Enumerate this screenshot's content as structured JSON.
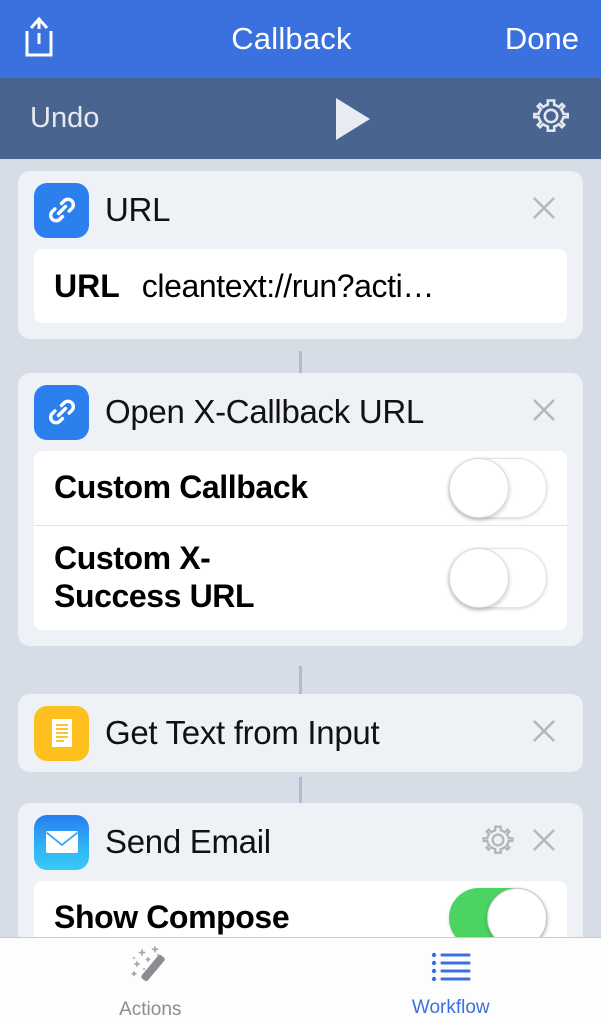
{
  "navbar": {
    "share_icon": "share-icon",
    "title": "Callback",
    "done_label": "Done"
  },
  "toolbar": {
    "undo_label": "Undo",
    "play_icon": "play-icon",
    "settings_icon": "gear-icon"
  },
  "colors": {
    "navbar_bg": "#3a71de",
    "toolbar_bg": "#4a6490",
    "page_bg": "#d7dde6",
    "card_bg": "#eef1f6",
    "accent_blue": "#2b80ee",
    "accent_yellow": "#fdc01f",
    "toggle_on_green": "#4cd462",
    "tab_active": "#3a71de",
    "tab_inactive": "#8c8c91"
  },
  "actions": [
    {
      "title": "URL",
      "icon": "link-icon",
      "icon_color": "#2b80ee",
      "close_icon": "close-icon",
      "params": [
        {
          "type": "text",
          "key": "URL",
          "value": "cleantext://run?acti…"
        }
      ]
    },
    {
      "title": "Open X-Callback URL",
      "icon": "link-icon",
      "icon_color": "#2b80ee",
      "close_icon": "close-icon",
      "params": [
        {
          "type": "switch",
          "label": "Custom Callback",
          "value": "off"
        },
        {
          "type": "switch",
          "label": "Custom X-\nSuccess URL",
          "value": "off"
        }
      ]
    },
    {
      "title": "Get Text from Input",
      "icon": "document-icon",
      "icon_color": "#fdc01f",
      "close_icon": "close-icon",
      "params": []
    },
    {
      "title": "Send Email",
      "icon": "mail-icon",
      "icon_color": "#2a7cf0",
      "settings_icon": "gear-icon",
      "close_icon": "close-icon",
      "params": [
        {
          "type": "switch",
          "label": "Show Compose",
          "value": "on"
        }
      ]
    }
  ],
  "tabbar": {
    "tabs": [
      {
        "label": "Actions",
        "icon": "magic-wand-icon",
        "active": false
      },
      {
        "label": "Workflow",
        "icon": "list-icon",
        "active": true
      }
    ]
  }
}
